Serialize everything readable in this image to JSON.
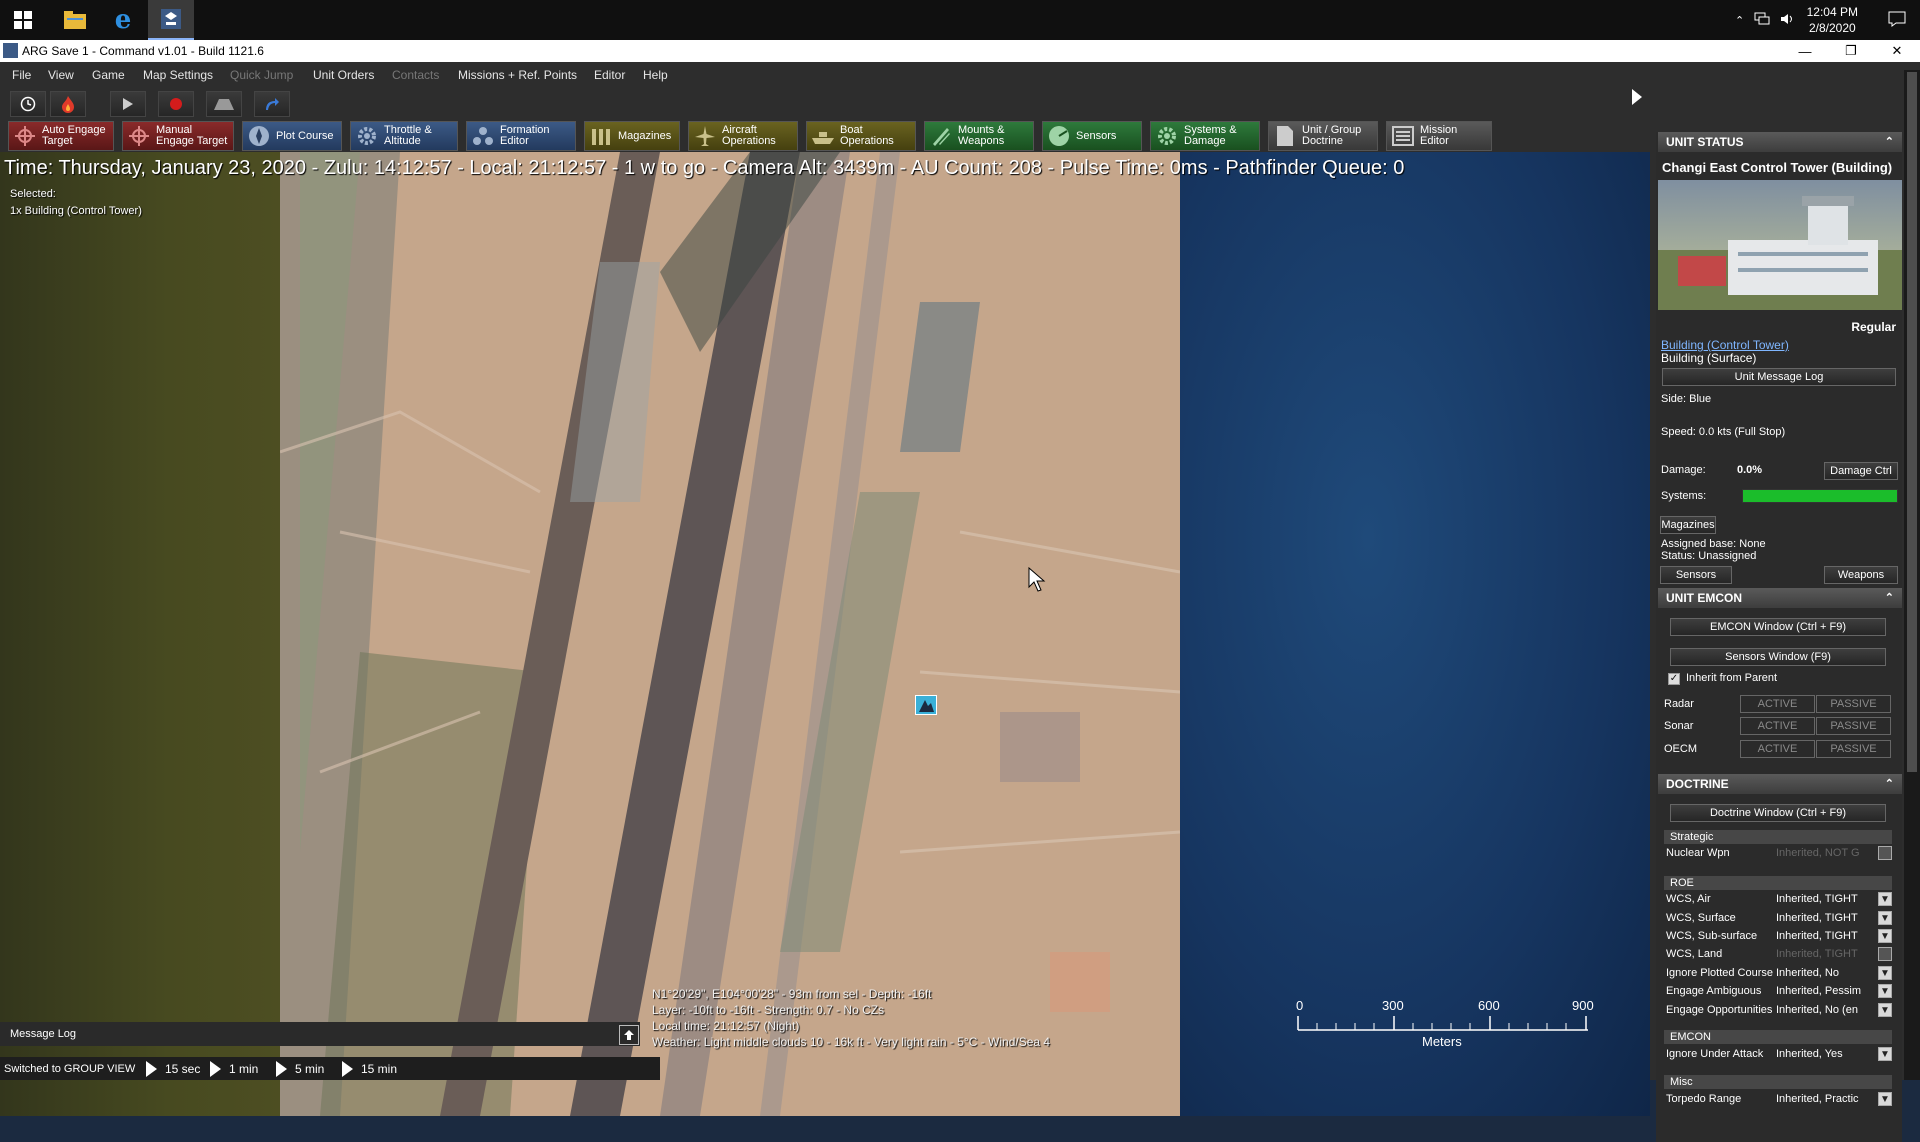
{
  "taskbar": {
    "time": "12:04 PM",
    "date": "2/8/2020"
  },
  "window": {
    "title": "ARG Save 1 - Command v1.01 - Build 1121.6"
  },
  "menu": {
    "items": [
      {
        "label": "File",
        "disabled": false
      },
      {
        "label": "View",
        "disabled": false
      },
      {
        "label": "Game",
        "disabled": false
      },
      {
        "label": "Map Settings",
        "disabled": false
      },
      {
        "label": "Quick Jump",
        "disabled": true
      },
      {
        "label": "Unit Orders",
        "disabled": false
      },
      {
        "label": "Contacts",
        "disabled": true
      },
      {
        "label": "Missions + Ref. Points",
        "disabled": false
      },
      {
        "label": "Editor",
        "disabled": false
      },
      {
        "label": "Help",
        "disabled": false
      }
    ]
  },
  "toolbar": {
    "buttons": [
      {
        "line1": "Auto Engage",
        "line2": "Target",
        "color": "#8a2a2a"
      },
      {
        "line1": "Manual",
        "line2": "Engage Target",
        "color": "#8a2a2a"
      },
      {
        "line1": "Plot Course",
        "line2": "",
        "color": "#3c5a86"
      },
      {
        "line1": "Throttle &",
        "line2": "Altitude",
        "color": "#3c5a86"
      },
      {
        "line1": "Formation",
        "line2": "Editor",
        "color": "#3c5a86"
      },
      {
        "line1": "Magazines",
        "line2": "",
        "color": "#6a6320"
      },
      {
        "line1": "Aircraft",
        "line2": "Operations",
        "color": "#6a6320"
      },
      {
        "line1": "Boat",
        "line2": "Operations",
        "color": "#6a6320"
      },
      {
        "line1": "Mounts &",
        "line2": "Weapons",
        "color": "#2e7a3c"
      },
      {
        "line1": "Sensors",
        "line2": "",
        "color": "#2e7a3c"
      },
      {
        "line1": "Systems &",
        "line2": "Damage",
        "color": "#2e7a3c"
      },
      {
        "line1": "Unit / Group",
        "line2": "Doctrine",
        "color": "#5a5a5a"
      },
      {
        "line1": "Mission",
        "line2": "Editor",
        "color": "#5a5a5a"
      }
    ]
  },
  "map": {
    "status_line": "Time: Thursday, January 23, 2020 - Zulu: 14:12:57 - Local: 21:12:57 - 1 w to go -  Camera Alt: 3439m  - AU Count: 208 - Pulse Time: 0ms - Pathfinder Queue: 0",
    "selected_label": "Selected:",
    "selected_value": "1x Building (Control Tower)",
    "cursor_info": [
      "N1°20'29\", E104°00'28\" - 93m from sel - Depth: -16ft",
      "Layer: -10ft to -16ft - Strength: 0.7 - No CZs",
      "Local time: 21:12:57 (Night)",
      "Weather: Light middle clouds 10 - 16k ft - Very light rain - 5°C - Wind/Sea 4"
    ],
    "scale_labels": [
      "0",
      "300",
      "600",
      "900"
    ],
    "scale_unit": "Meters"
  },
  "message_log": {
    "label": "Message Log"
  },
  "bottom": {
    "status": "Switched to GROUP VIEW",
    "speeds": [
      "15 sec",
      "1 min",
      "5 min",
      "15 min"
    ]
  },
  "unit_status": {
    "header": "UNIT STATUS",
    "name": "Changi East Control Tower (Building)",
    "proficiency": "Regular",
    "class_link": "Building (Control Tower)",
    "type": "Building (Surface)",
    "message_log_btn": "Unit Message Log",
    "side": "Side: Blue",
    "speed": "Speed: 0.0 kts (Full Stop)",
    "damage_label": "Damage:",
    "damage_value": "0.0%",
    "damage_ctrl_btn": "Damage Ctrl",
    "systems_label": "Systems:",
    "systems_health": 1.0,
    "magazines_btn": "Magazines",
    "assigned_base": "Assigned base: None",
    "status": "Status: Unassigned",
    "sensors_btn": "Sensors",
    "weapons_btn": "Weapons"
  },
  "emcon": {
    "header": "UNIT EMCON",
    "emcon_window_btn": "EMCON Window (Ctrl + F9)",
    "sensors_window_btn": "Sensors Window (F9)",
    "inherit_label": "Inherit from Parent",
    "rows": [
      {
        "label": "Radar",
        "active": "ACTIVE",
        "passive": "PASSIVE"
      },
      {
        "label": "Sonar",
        "active": "ACTIVE",
        "passive": "PASSIVE"
      },
      {
        "label": "OECM",
        "active": "ACTIVE",
        "passive": "PASSIVE"
      }
    ]
  },
  "doctrine": {
    "header": "DOCTRINE",
    "window_btn": "Doctrine Window (Ctrl + F9)",
    "groups": [
      {
        "name": "Strategic",
        "rows": [
          {
            "k": "Nuclear Wpn",
            "v": "Inherited, NOT G",
            "dim": true
          }
        ]
      },
      {
        "name": "ROE",
        "rows": [
          {
            "k": "WCS, Air",
            "v": "Inherited, TIGHT",
            "dim": false
          },
          {
            "k": "WCS, Surface",
            "v": "Inherited, TIGHT",
            "dim": false
          },
          {
            "k": "WCS, Sub-surface",
            "v": "Inherited, TIGHT",
            "dim": false
          },
          {
            "k": "WCS, Land",
            "v": "Inherited, TIGHT",
            "dim": true
          },
          {
            "k": "Ignore Plotted Course",
            "v": "Inherited, No",
            "dim": false
          },
          {
            "k": "Engage Ambiguous",
            "v": "Inherited, Pessim",
            "dim": false
          },
          {
            "k": "Engage Opportunities",
            "v": "Inherited, No (en",
            "dim": false
          }
        ]
      },
      {
        "name": "EMCON",
        "rows": [
          {
            "k": "Ignore Under Attack",
            "v": "Inherited, Yes",
            "dim": false
          }
        ]
      },
      {
        "name": "Misc",
        "rows": [
          {
            "k": "Torpedo Range",
            "v": "Inherited, Practic",
            "dim": false
          }
        ]
      }
    ]
  }
}
